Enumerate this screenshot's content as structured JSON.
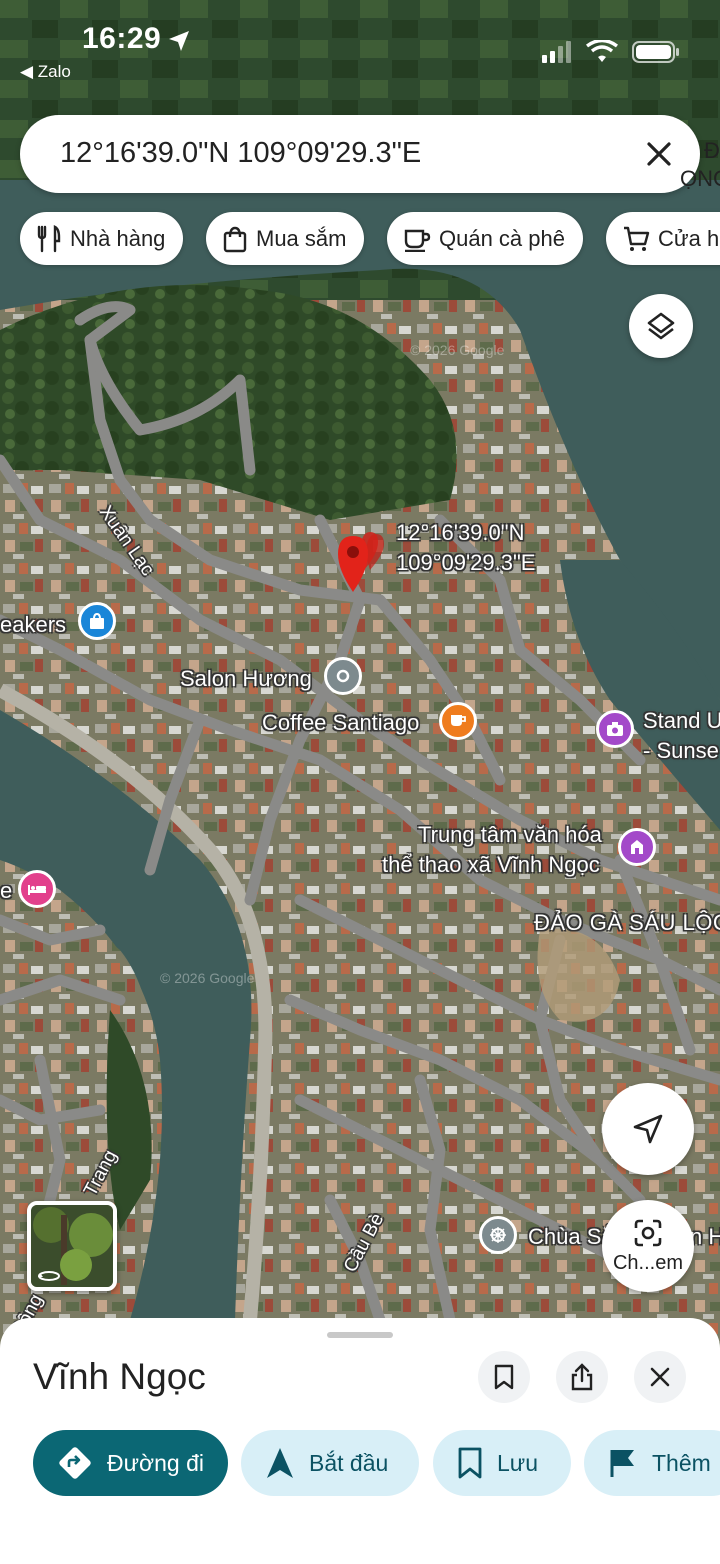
{
  "status_bar": {
    "time": "16:29",
    "back_app": "◀ Zalo"
  },
  "search": {
    "query": "12°16'39.0\"N 109°09'29.3\"E"
  },
  "chips": [
    {
      "label": "Nhà hàng",
      "icon": "restaurant-icon"
    },
    {
      "label": "Mua sắm",
      "icon": "shopping-bag-icon"
    },
    {
      "label": "Quán cà phê",
      "icon": "coffee-cup-icon"
    },
    {
      "label": "Cửa h",
      "icon": "shopping-cart-icon"
    }
  ],
  "map": {
    "pin_coords": [
      "12°16'39.0\"N",
      "109°09'29.3\"E"
    ],
    "labels": {
      "xuan_lac": "Xuân Lạc",
      "eakers": "eakers",
      "salon": "Salon Hương",
      "coffee": "Coffee Santiago",
      "stand_1": "Stand U",
      "stand_2": "- Sunse",
      "trung_tam_1": "Trung tâm văn hóa",
      "trung_tam_2": "thể thao xã Vĩnh Ngọc",
      "dao_ga": "ĐẢO GÀ SÁU LỘC",
      "hotel_e": "e",
      "trang": "Trang",
      "song": "Sông",
      "cau_be": "Cầu Bè",
      "chua": "Chùa Sắ",
      "chua_tail": "n H",
      "d_right": "Đ",
      "ngo_right": "ỌNG",
      "watermark": "© 2026 Google"
    },
    "search_image_label": "Ch...em",
    "colors": {
      "river": "#3f5d5b",
      "road": "#8a8a88",
      "pin": "#e2231a"
    }
  },
  "sheet": {
    "title": "Vĩnh Ngọc",
    "actions": [
      {
        "label": "Đường đi",
        "icon": "directions-icon"
      },
      {
        "label": "Bắt đầu",
        "icon": "navigation-arrow-icon"
      },
      {
        "label": "Lưu",
        "icon": "bookmark-icon"
      },
      {
        "label": "Thêm",
        "icon": "flag-icon"
      }
    ]
  }
}
